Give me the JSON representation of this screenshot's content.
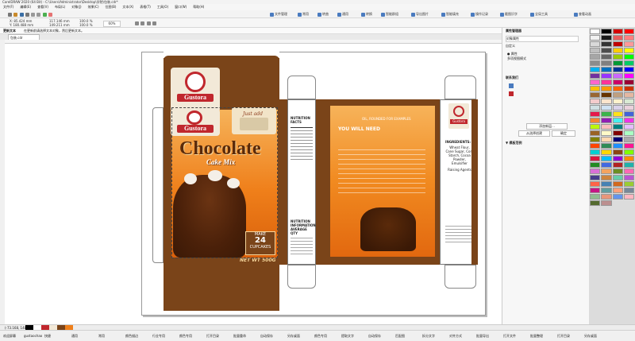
{
  "window": {
    "title": "CorelDRAW 2020 (64 Bit) - C:\\Users\\Administrator\\Desktop\\学院\\包装.cdr*"
  },
  "menu": [
    "文件(F)",
    "编辑(E)",
    "查看(V)",
    "布局(L)",
    "对象(J)",
    "效果(C)",
    "位图(B)",
    "文本(X)",
    "表格(T)",
    "工具(O)",
    "窗口(W)",
    "帮助(H)"
  ],
  "toolbar1": [
    "文件管理",
    "常用",
    "转曲",
    "通用",
    "转换",
    "智能群组",
    "导出图片",
    "智能填充",
    "操作记录",
    "截图识字",
    "全局工具",
    "查看动画"
  ],
  "toolbar2": {
    "x": "85.424 mm",
    "y": "180.488 mm",
    "w": "117.146 mm",
    "h": "149.211 mm",
    "sx": "100.0",
    "sy": "100.0",
    "unit": "%",
    "zoom": "60%"
  },
  "toolbar3": {
    "msg": "更新文本",
    "hint": "在更新前请选择文本对象，然后更新文本。"
  },
  "doc_tab": "包装.cdr",
  "panel": {
    "title": "属性管理器",
    "header": "对象属性",
    "field_label": "自定义",
    "items": [
      "● 属性",
      "  多项视图模式"
    ],
    "section": "联系我们",
    "buttons": [
      "添加新层...",
      "从选择创建",
      "确定"
    ],
    "section2": "▼ 模板范例"
  },
  "box": {
    "brand": "Gustora",
    "title": "Chocolate",
    "subtitle": "Cake Mix",
    "make": "MAKE",
    "make_num": "24",
    "make_unit": "CUPCAKES",
    "net_wt": "NET WT 500G",
    "nutrition": "NUTRITION FACTS",
    "nutrition2": "NUTRITION INFORMATION AVERAGE QTY",
    "you_will_need": "YOU WILL NEED",
    "back_header": "OIL, ROUNDED FOR EXAMPLES",
    "ingredients_title": "INGREDIENTS:",
    "ingredients": "Wheat Flour, Cane Sugar, Corn Starch, Cocoa Powder, Emulsifier",
    "ingredients2": "Raising Agents",
    "handwritten": "Just add"
  },
  "statusbar": {
    "coords": "(-73.168, 148.487)",
    "fill": "无填充",
    "outline": "极细 [C:0 M:0 Y:0 K:100] 0.200 mm"
  },
  "taskbar": [
    "欢迎屏幕",
    "gustaochao",
    "快捷",
    "通用",
    "常用",
    "颜色描边",
    "行业专用",
    "颜色专用",
    "打开目录",
    "批量重命",
    "自动保存",
    "另存桌面",
    "颜色专用",
    "提取文字",
    "自动保存",
    "匹配图",
    "拆分文字",
    "对齐方式",
    "批量导出",
    "打开文件",
    "批量整理",
    "打开目录",
    "另存桌面"
  ],
  "palette_colors": [
    "#ffffff",
    "#000000",
    "#d40000",
    "#ff0000",
    "#f2f2f2",
    "#1a1a1a",
    "#e85d5d",
    "#ff7f7f",
    "#d9d9d9",
    "#333333",
    "#c00000",
    "#ff9999",
    "#bfbfbf",
    "#4d4d4d",
    "#ffcc00",
    "#ffff00",
    "#a6a6a6",
    "#666666",
    "#99cc00",
    "#00ff00",
    "#8c8c8c",
    "#808080",
    "#009933",
    "#00cc66",
    "#00b0f0",
    "#0070c0",
    "#003399",
    "#0000ff",
    "#7030a0",
    "#9933ff",
    "#cc66ff",
    "#ff00ff",
    "#ff66cc",
    "#ff3399",
    "#cc0066",
    "#990033",
    "#ffc000",
    "#ff9900",
    "#ff6600",
    "#cc3300",
    "#996633",
    "#663300",
    "#c0a080",
    "#e6b8a2",
    "#f4cccc",
    "#fce5cd",
    "#fff2cc",
    "#d9ead3",
    "#d0e0e3",
    "#cfe2f3",
    "#d9d2e9",
    "#ead1dc",
    "#e6194b",
    "#3cb44b",
    "#ffe119",
    "#4363d8",
    "#f58231",
    "#911eb4",
    "#46f0f0",
    "#f032e6",
    "#bcf60c",
    "#fabebe",
    "#008080",
    "#e6beff",
    "#9a6324",
    "#fffac8",
    "#800000",
    "#aaffc3",
    "#808000",
    "#ffd8b1",
    "#000075",
    "#a9a9a9",
    "#ff4500",
    "#2e8b57",
    "#1e90ff",
    "#ff1493",
    "#00ced1",
    "#ffd700",
    "#8b4513",
    "#7fff00",
    "#dc143c",
    "#00bfff",
    "#9400d3",
    "#ff8c00",
    "#228b22",
    "#4169e1",
    "#b22222",
    "#20b2aa",
    "#da70d6",
    "#f4a460",
    "#6b8e23",
    "#ff69b4",
    "#483d8b",
    "#cd853f",
    "#66cdaa",
    "#ba55d3",
    "#ff6347",
    "#4682b4",
    "#d2691e",
    "#9acd32",
    "#c71585",
    "#5f9ea0",
    "#ffa07a",
    "#778899",
    "#8fbc8f",
    "#e9967a",
    "#6495ed",
    "#ffb6c1",
    "#556b2f",
    "#bc8f8f"
  ]
}
